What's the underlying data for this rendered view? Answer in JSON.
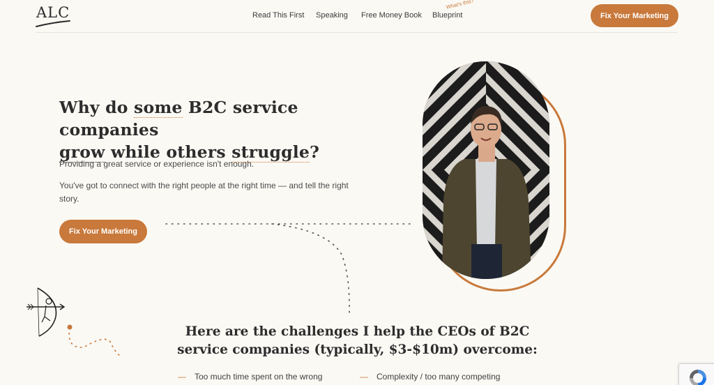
{
  "header": {
    "logo_text": "ALC",
    "nav": [
      {
        "label": "Read This First"
      },
      {
        "label": "Speaking"
      },
      {
        "label": "Free Money Book"
      },
      {
        "label": "Blueprint"
      }
    ],
    "blueprint_note": "What's this?",
    "cta_label": "Fix Your Marketing"
  },
  "hero": {
    "headline_parts": [
      "Why do ",
      "some",
      " B2C service companies",
      "grow",
      " while others ",
      "struggle",
      "?"
    ],
    "paragraph_1": "Providing a great service or experience isn't enough.",
    "paragraph_2": "You've got to connect with the right people at the right time — and tell the right story.",
    "cta_label": "Fix Your Marketing"
  },
  "challenges": {
    "title": "Here are the challenges I help the CEOs of B2C service companies (typically, $3-$10m) overcome:",
    "items": [
      {
        "dash": "—",
        "text": "Too much time spent on the wrong"
      },
      {
        "dash": "—",
        "text": "Complexity / too many competing"
      }
    ]
  },
  "colors": {
    "accent": "#c8793b",
    "background": "#fbf9f4",
    "text": "#2d2d2d"
  },
  "icons": [
    "archer-icon",
    "recaptcha-icon"
  ]
}
